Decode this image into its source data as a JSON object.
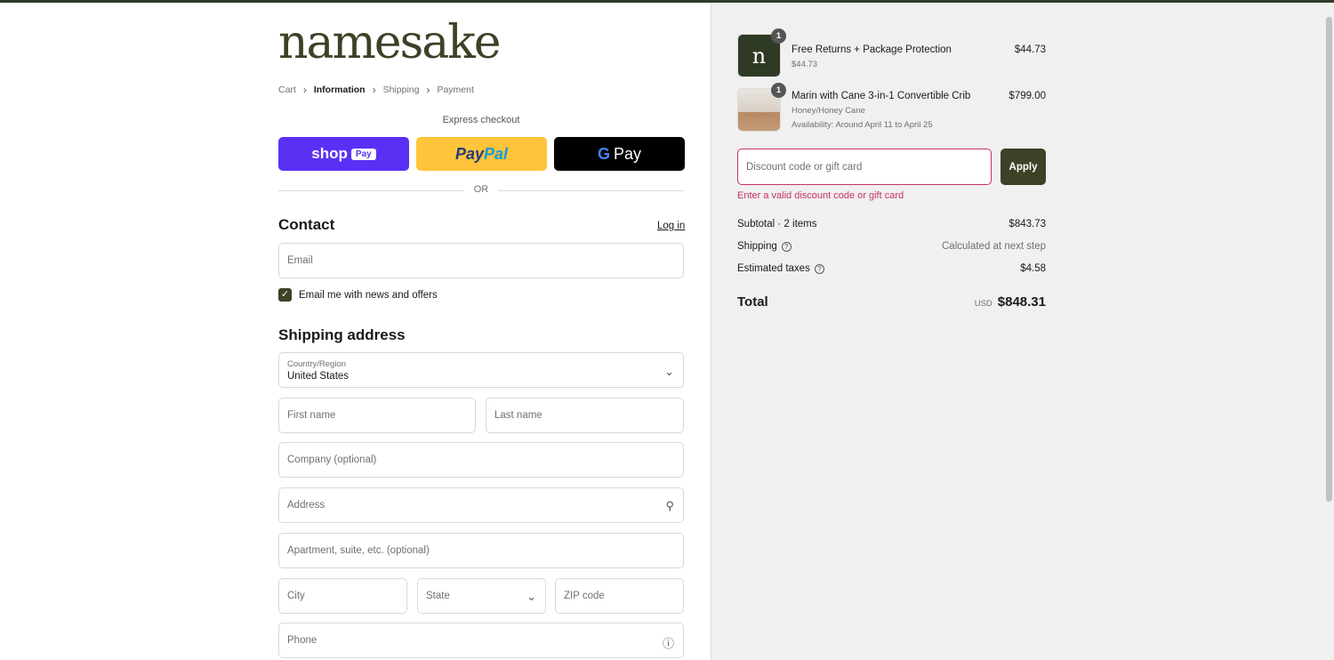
{
  "brand": {
    "logo": "namesake"
  },
  "breadcrumbs": [
    {
      "label": "Cart"
    },
    {
      "label": "Information",
      "active": true
    },
    {
      "label": "Shipping"
    },
    {
      "label": "Payment"
    }
  ],
  "express": {
    "heading": "Express checkout",
    "shop_label": "shop",
    "shop_pay": "Pay",
    "paypal_a": "Pay",
    "paypal_b": "Pal",
    "gpay_g": "G",
    "gpay_label": "Pay",
    "or": "OR"
  },
  "contact": {
    "heading": "Contact",
    "login": "Log in",
    "email_placeholder": "Email",
    "newsletter_label": "Email me with news and offers",
    "newsletter_checked": true
  },
  "shipping": {
    "heading": "Shipping address",
    "country_label": "Country/Region",
    "country_value": "United States",
    "first_name": "First name",
    "last_name": "Last name",
    "company": "Company (optional)",
    "address": "Address",
    "apartment": "Apartment, suite, etc. (optional)",
    "city": "City",
    "state": "State",
    "zip": "ZIP code",
    "phone": "Phone"
  },
  "order": {
    "items": [
      {
        "qty": "1",
        "name": "Free Returns + Package Protection",
        "sub": "$44.73",
        "sub2": "",
        "price": "$44.73",
        "thumb_letter": "n"
      },
      {
        "qty": "1",
        "name": "Marin with Cane 3-in-1 Convertible Crib",
        "sub": "Honey/Honey Cane",
        "sub2": "Availability: Around April 11 to April 25",
        "price": "$799.00"
      }
    ],
    "discount_placeholder": "Discount code or gift card",
    "apply": "Apply",
    "discount_error": "Enter a valid discount code or gift card",
    "subtotal_label": "Subtotal · 2 items",
    "subtotal": "$843.73",
    "shipping_label": "Shipping",
    "shipping_value": "Calculated at next step",
    "taxes_label": "Estimated taxes",
    "taxes": "$4.58",
    "total_label": "Total",
    "currency": "USD",
    "total": "$848.31"
  },
  "colors": {
    "accent": "#3b4226",
    "error": "#c6345d",
    "shop": "#5a31f4",
    "paypal": "#ffc43a"
  }
}
